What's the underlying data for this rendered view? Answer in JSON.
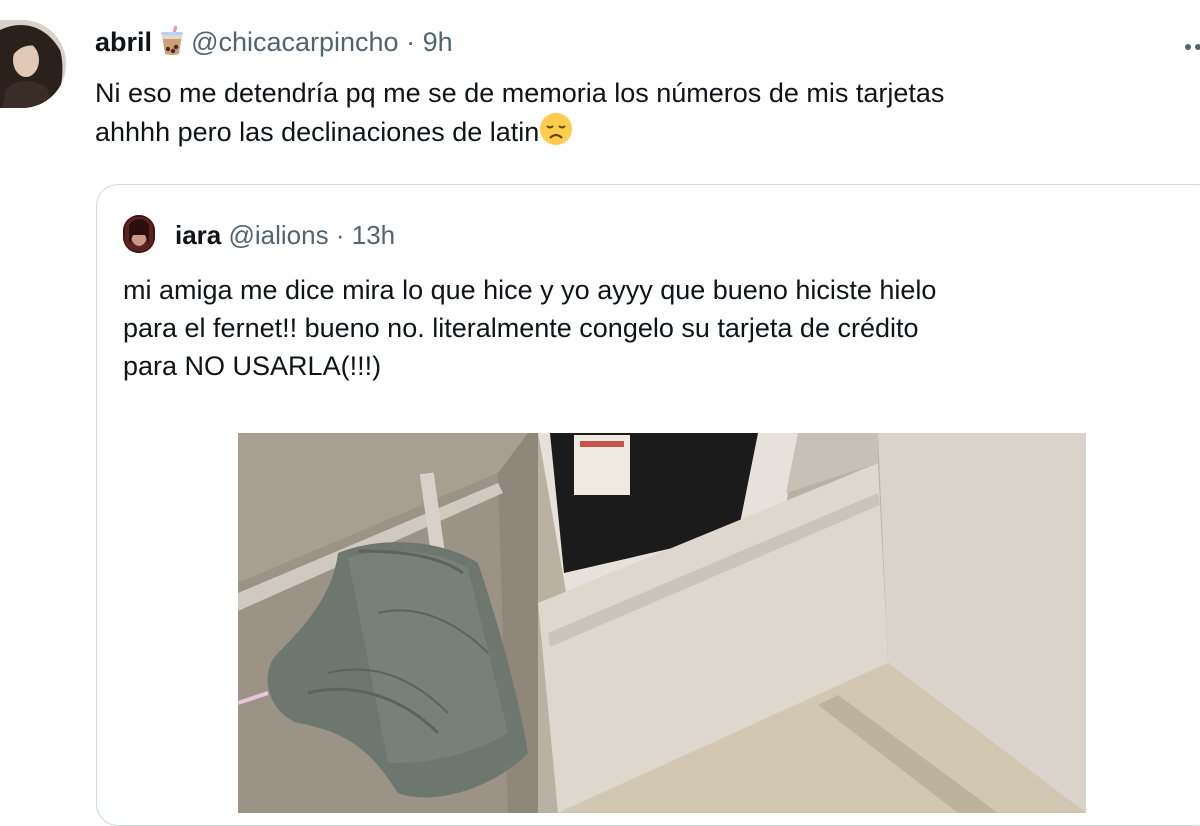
{
  "tweet": {
    "author_name": "abril",
    "author_name_emoji": "bubble-tea-emoji",
    "handle": "@chicacarpincho",
    "separator": "·",
    "time": "9h",
    "text_line1": "Ni eso me detendría pq me se de memoria los números de mis tarjetas",
    "text_line2": "ahhhh pero las declinaciones de latin",
    "text_emoji": "disappointed-face-emoji"
  },
  "quoted": {
    "author_name": "iara",
    "handle": "@ialions",
    "separator": "·",
    "time": "13h",
    "text_line1": "mi amiga me dice mira lo que hice y yo ayyy que bueno hiciste hielo",
    "text_line2": "para el fernet!! bueno no. literalmente congelo su tarjeta de crédito",
    "text_line3": "para NO USARLA(!!!)",
    "media": "photo of a kitchen freezer drawer with a grey towel hanging on its handle, an oven above and a beige tiled floor"
  },
  "colors": {
    "text": "#0f1419",
    "muted": "#536471",
    "border": "#cfd9de",
    "background": "#ffffff"
  },
  "icons": [
    "more-options-icon",
    "bubble-tea-emoji",
    "disappointed-face-emoji"
  ]
}
